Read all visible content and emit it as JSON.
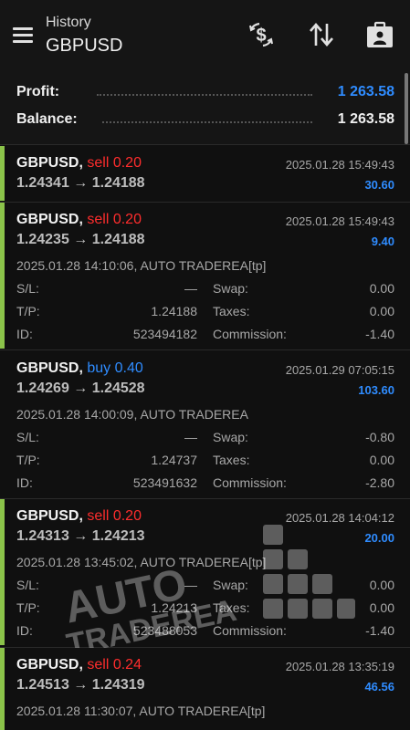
{
  "header": {
    "subtitle": "History",
    "title": "GBPUSD"
  },
  "summary": {
    "profit_label": "Profit:",
    "profit_value": "1 263.58",
    "balance_label": "Balance:",
    "balance_value": "1 263.58"
  },
  "colors": {
    "accent_blue": "#2f8cff",
    "sell_red": "#ff2d2d",
    "bar_green": "#8bc34a",
    "background": "#101010"
  },
  "icons": [
    "menu-icon",
    "currency-exchange-icon",
    "sort-icon",
    "briefcase-icon"
  ],
  "deals": [
    {
      "symbol": "GBPUSD,",
      "side": "sell",
      "volume": "0.20",
      "prices": "1.24341 → 1.24188",
      "time": "2025.01.28 15:49:43",
      "profit": "30.60"
    },
    {
      "symbol": "GBPUSD,",
      "side": "sell",
      "volume": "0.20",
      "prices": "1.24235 → 1.24188",
      "time": "2025.01.28 15:49:43",
      "profit": "9.40",
      "comment": "2025.01.28 14:10:06, AUTO TRADEREA[tp]",
      "sl_label": "S/L:",
      "sl": "—",
      "swap_label": "Swap:",
      "swap": "0.00",
      "tp_label": "T/P:",
      "tp": "1.24188",
      "taxes_label": "Taxes:",
      "taxes": "0.00",
      "id_label": "ID:",
      "id": "523494182",
      "commission_label": "Commission:",
      "commission": "-1.40"
    },
    {
      "symbol": "GBPUSD,",
      "side": "buy",
      "volume": "0.40",
      "prices": "1.24269 → 1.24528",
      "time": "2025.01.29 07:05:15",
      "profit": "103.60",
      "comment": "2025.01.28 14:00:09, AUTO TRADEREA",
      "sl_label": "S/L:",
      "sl": "—",
      "swap_label": "Swap:",
      "swap": "-0.80",
      "tp_label": "T/P:",
      "tp": "1.24737",
      "taxes_label": "Taxes:",
      "taxes": "0.00",
      "id_label": "ID:",
      "id": "523491632",
      "commission_label": "Commission:",
      "commission": "-2.80"
    },
    {
      "symbol": "GBPUSD,",
      "side": "sell",
      "volume": "0.20",
      "prices": "1.24313 → 1.24213",
      "time": "2025.01.28 14:04:12",
      "profit": "20.00",
      "comment": "2025.01.28 13:45:02, AUTO TRADEREA[tp]",
      "sl_label": "S/L:",
      "sl": "—",
      "swap_label": "Swap:",
      "swap": "0.00",
      "tp_label": "T/P:",
      "tp": "1.24213",
      "taxes_label": "Taxes:",
      "taxes": "0.00",
      "id_label": "ID:",
      "id": "523488053",
      "commission_label": "Commission:",
      "commission": "-1.40"
    },
    {
      "symbol": "GBPUSD,",
      "side": "sell",
      "volume": "0.24",
      "prices": "1.24513 → 1.24319",
      "time": "2025.01.28 13:35:19",
      "profit": "46.56",
      "comment": "2025.01.28 11:30:07, AUTO TRADEREA[tp]"
    }
  ],
  "watermark": {
    "line1": "AUTO",
    "line2": "TRADEREA"
  }
}
